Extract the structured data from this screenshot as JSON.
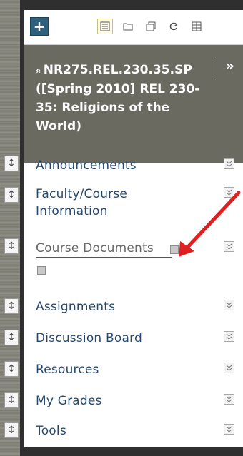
{
  "toolbar": {
    "add_icon": "plus-icon",
    "icons": [
      "list-view-icon",
      "folder-icon",
      "windows-icon",
      "refresh-icon",
      "grid-view-icon"
    ]
  },
  "course": {
    "title": "NR275.REL.230.35.SP ([Spring 2010] REL 230-35: Religions of the World)",
    "collapse_symbol": "«",
    "expand_symbol": "»"
  },
  "menu": {
    "items": [
      {
        "label": "Announcements"
      },
      {
        "label": "Faculty/Course Information"
      },
      {
        "label": "Course Documents"
      },
      {
        "label": "Assignments"
      },
      {
        "label": "Discussion Board"
      },
      {
        "label": "Resources"
      },
      {
        "label": "My Grades"
      },
      {
        "label": "Tools"
      }
    ]
  },
  "annotation": {
    "arrow_color": "#e02020"
  }
}
